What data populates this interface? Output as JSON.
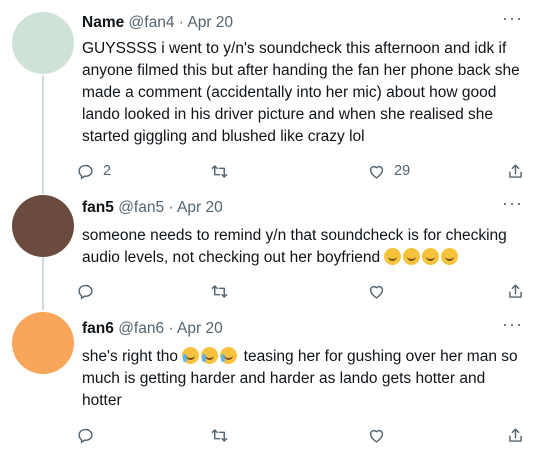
{
  "tweets": [
    {
      "name": "Name",
      "handle": "@fan4",
      "separator": "·",
      "date": "Apr 20",
      "text": "GUYSSSS i went to y/n's soundcheck this afternoon and idk if anyone filmed this but after handing the fan her phone back she made a comment (accidentally into her mic) about how good lando looked in his driver picture and when she realised she started giggling and blushed like crazy lol",
      "avatar_color": "#cfe2d8",
      "replies": "2",
      "retweets": "",
      "likes": "29",
      "more": "···"
    },
    {
      "name": "fan5",
      "handle": "@fan5",
      "separator": "·",
      "date": "Apr 20",
      "text": "someone needs to remind y/n that soundcheck is for checking audio levels, not checking out her boyfriend",
      "emojis": [
        "rolling-on-floor-laughing",
        "rolling-on-floor-laughing",
        "rolling-on-floor-laughing",
        "rolling-on-floor-laughing"
      ],
      "avatar_color": "#6b4b3e",
      "replies": "",
      "retweets": "",
      "likes": "",
      "more": "···"
    },
    {
      "name": "fan6",
      "handle": "@fan6",
      "separator": "·",
      "date": "Apr 20",
      "text_before": "she's right tho",
      "emojis": [
        "loudly-crying-face",
        "loudly-crying-face",
        "loudly-crying-face"
      ],
      "text_after": "teasing her for gushing over her man so much is getting harder and harder as lando gets hotter and hotter",
      "avatar_color": "#f7a65a",
      "replies": "",
      "retweets": "",
      "likes": "",
      "more": "···"
    }
  ],
  "colors": {
    "muted": "#536471",
    "text": "#0f1419",
    "thread_line": "#cfd9de"
  }
}
